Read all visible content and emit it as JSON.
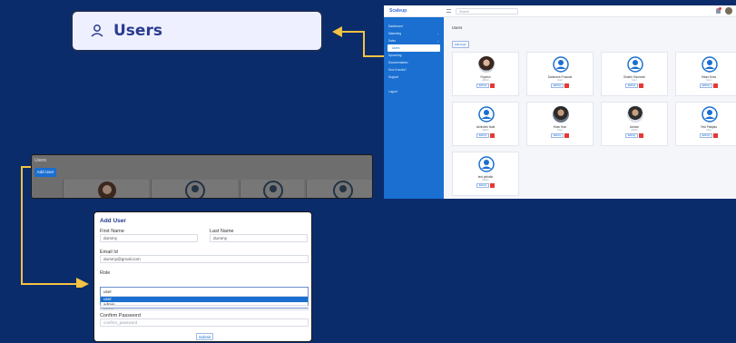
{
  "callout": {
    "label": "Users"
  },
  "app": {
    "logo": "Scaleup",
    "search_placeholder": "Search",
    "sidebar": [
      {
        "label": "Dashboard",
        "chev": ""
      },
      {
        "label": "Marketing",
        "chev": "⌄"
      },
      {
        "label": "Sales",
        "chev": "⌄"
      },
      {
        "label": "Users",
        "chev": ""
      },
      {
        "label": "Upcoming",
        "chev": ""
      },
      {
        "label": "Documentation",
        "chev": ""
      },
      {
        "label": "How it works?",
        "chev": ""
      },
      {
        "label": "Support",
        "chev": ""
      },
      {
        "label": "Logout",
        "chev": ""
      }
    ],
    "page_title": "Users",
    "add_user": "Add User",
    "cards": [
      {
        "name": "Rupesh",
        "role": "Admin",
        "avatar": "photo-w"
      },
      {
        "name": "Darshanb Prasads",
        "role": "User",
        "avatar": "generic"
      },
      {
        "name": "Shaikh Shumesh",
        "role": "User",
        "avatar": "generic"
      },
      {
        "name": "Hikas Kirsa",
        "role": "User",
        "avatar": "generic"
      },
      {
        "name": "Abhishek Naik",
        "role": "Admin",
        "avatar": "generic"
      },
      {
        "name": "Kiran Mon",
        "role": "User",
        "avatar": "photo-m1"
      },
      {
        "name": "Ashwin",
        "role": "Admin",
        "avatar": "photo-m2"
      },
      {
        "name": "Test Palkjala",
        "role": "User",
        "avatar": "generic"
      },
      {
        "name": "test pahalto",
        "role": "Admin",
        "avatar": "generic"
      }
    ],
    "edit_label": "Edit/Ap"
  },
  "strip": {
    "title": "Users",
    "add_user": "Add User"
  },
  "form": {
    "title": "Add User",
    "first_name_label": "First Name",
    "first_name_value": "dummy",
    "last_name_label": "Last Name",
    "last_name_value": "dummy",
    "email_label": "Email Id",
    "email_value": "dummy@gmail.com",
    "role_label": "Role",
    "role_selected": "user",
    "role_options": [
      "user",
      "admin"
    ],
    "password_value": "••••••••",
    "confirm_label": "Confirm Password",
    "confirm_placeholder": "confirm_password",
    "submit": "Submit"
  },
  "colors": {
    "background": "#0b2c6b",
    "accent": "#1a6fd1",
    "arrow": "#f5c242"
  }
}
